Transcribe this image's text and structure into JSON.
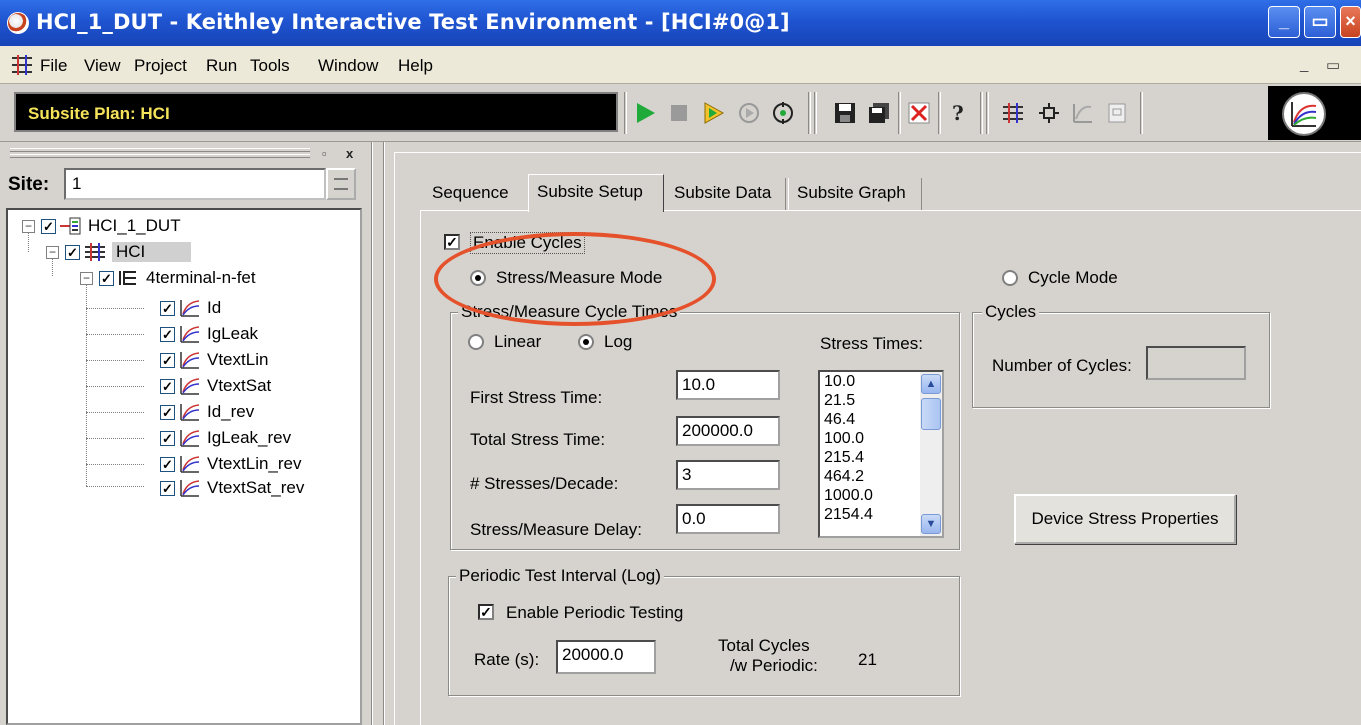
{
  "window": {
    "title": "HCI_1_DUT - Keithley Interactive Test Environment - [HCI#0@1]",
    "controls": {
      "minimize": "_",
      "restore": "▭"
    }
  },
  "menubar": {
    "items": [
      "File",
      "View",
      "Project",
      "Run",
      "Tools",
      "Window",
      "Help"
    ],
    "mdi": {
      "minimize": "_",
      "restore": "▭"
    }
  },
  "toolbar": {
    "plan_label": "Subsite Plan: HCI",
    "icons": [
      "run-icon",
      "stop-icon",
      "run-step-icon",
      "cycle-icon",
      "target-icon",
      "save-icon",
      "save-all-icon",
      "delete-icon",
      "help-icon",
      "project-icon",
      "device-icon",
      "test-icon",
      "doc-icon",
      "graph-icon"
    ]
  },
  "left_pane": {
    "pane_buttons": {
      "pin": "▫",
      "close": "x"
    },
    "site_label": "Site:",
    "site_value": "1",
    "tree": [
      {
        "label": "HCI_1_DUT",
        "icon": "project-icon",
        "level": 0
      },
      {
        "label": "HCI",
        "icon": "subsite-icon",
        "level": 1
      },
      {
        "label": "4terminal-n-fet",
        "icon": "device-icon",
        "level": 2
      },
      {
        "label": "Id",
        "icon": "test-icon",
        "level": 3
      },
      {
        "label": "IgLeak",
        "icon": "test-icon",
        "level": 3
      },
      {
        "label": "VtextLin",
        "icon": "test-icon",
        "level": 3
      },
      {
        "label": "VtextSat",
        "icon": "test-icon",
        "level": 3
      },
      {
        "label": "Id_rev",
        "icon": "test-icon",
        "level": 3
      },
      {
        "label": "IgLeak_rev",
        "icon": "test-icon",
        "level": 3
      },
      {
        "label": "VtextLin_rev",
        "icon": "test-icon",
        "level": 3
      },
      {
        "label": "VtextSat_rev",
        "icon": "test-icon",
        "level": 3
      }
    ]
  },
  "tabs": [
    "Sequence",
    "Subsite Setup",
    "Subsite Data",
    "Subsite Graph"
  ],
  "active_tab": "Subsite Setup",
  "setup": {
    "enable_cycles": {
      "label": "Enable Cycles",
      "checked": true
    },
    "mode_stress_measure": {
      "label": "Stress/Measure Mode",
      "selected": true
    },
    "mode_cycle": {
      "label": "Cycle Mode",
      "selected": false
    },
    "cycle_times": {
      "title": "Stress/Measure Cycle Times",
      "linear_label": "Linear",
      "log_label": "Log",
      "scale": "Log",
      "stress_times_label": "Stress Times:",
      "stress_times": [
        "10.0",
        "21.5",
        "46.4",
        "100.0",
        "215.4",
        "464.2",
        "1000.0",
        "2154.4"
      ],
      "first_stress_time": {
        "label": "First Stress Time:",
        "value": "10.0"
      },
      "total_stress_time": {
        "label": "Total Stress Time:",
        "value": "200000.0"
      },
      "stresses_per_decade": {
        "label": "# Stresses/Decade:",
        "value": "3"
      },
      "stress_measure_delay": {
        "label": "Stress/Measure Delay:",
        "value": "0.0"
      }
    },
    "cycles": {
      "title": "Cycles",
      "number_label": "Number of Cycles:",
      "number_value": ""
    },
    "device_stress_button": "Device Stress Properties",
    "periodic": {
      "title": "Periodic Test Interval (Log)",
      "enable_label": "Enable Periodic Testing",
      "enabled": true,
      "rate_label": "Rate (s):",
      "rate_value": "20000.0",
      "total_cycles_label_1": "Total Cycles",
      "total_cycles_label_2": "/w Periodic:",
      "total_cycles_value": "21"
    }
  },
  "colors": {
    "titlebar": "#1f54d0",
    "plan_text": "#f5e35a",
    "annotation": "#e5512a",
    "run_green": "#1faa3a"
  }
}
